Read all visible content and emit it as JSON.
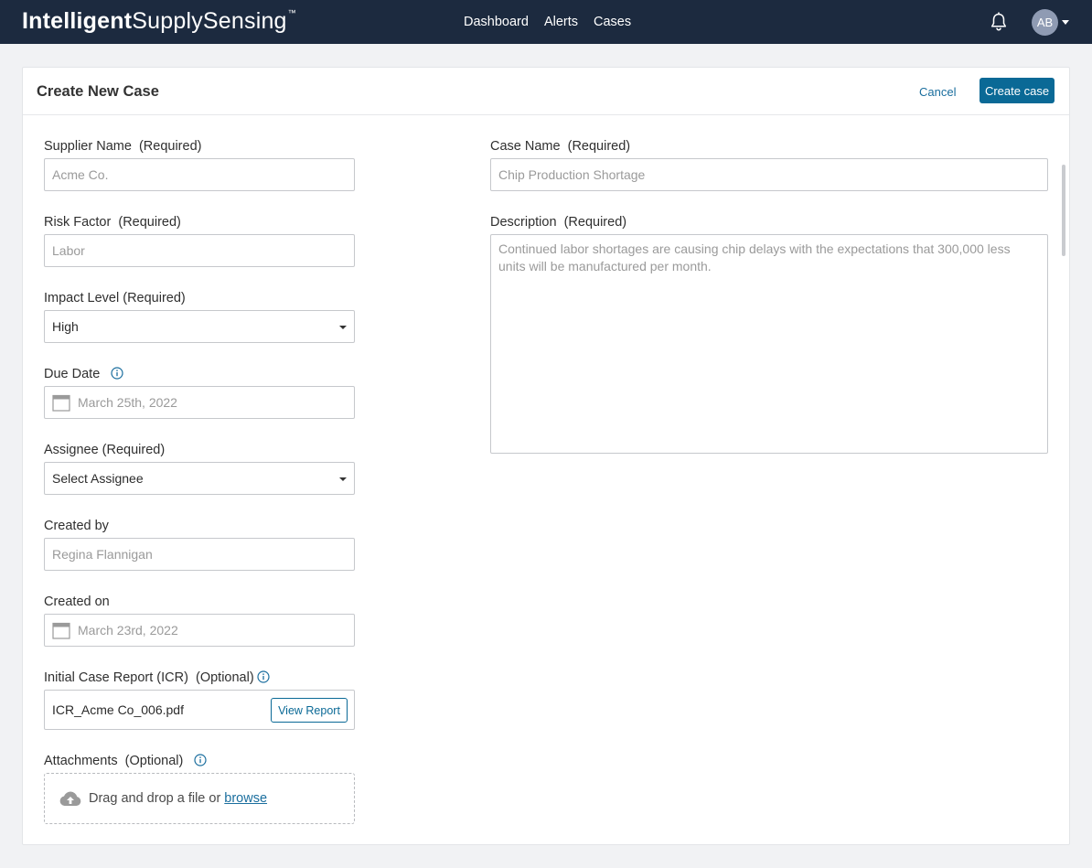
{
  "app": {
    "brand_bold": "Intelligent",
    "brand_rest": "SupplySensing",
    "brand_tm": "™",
    "nav": [
      "Dashboard",
      "Alerts",
      "Cases"
    ],
    "avatar_initials": "AB"
  },
  "page": {
    "title": "Create New Case",
    "cancel_label": "Cancel",
    "create_label": "Create case"
  },
  "form": {
    "supplier_name": {
      "label": "Supplier Name  (Required)",
      "placeholder": "Acme Co."
    },
    "risk_factor": {
      "label": "Risk Factor  (Required)",
      "placeholder": "Labor"
    },
    "impact_level": {
      "label": "Impact Level (Required)",
      "value": "High"
    },
    "due_date": {
      "label": "Due Date",
      "placeholder": "March 25th, 2022"
    },
    "assignee": {
      "label": "Assignee (Required)",
      "value": "Select Assignee"
    },
    "created_by": {
      "label": "Created by",
      "placeholder": "Regina Flannigan"
    },
    "created_on": {
      "label": "Created on",
      "placeholder": "March 23rd, 2022"
    },
    "icr": {
      "label": "Initial Case Report (ICR)  (Optional)",
      "file_name": "ICR_Acme Co_006.pdf",
      "button_label": "View Report"
    },
    "attachments": {
      "label": "Attachments  (Optional)",
      "drop_text": "Drag and drop a file or",
      "browse_label": "browse"
    },
    "case_name": {
      "label": "Case Name  (Required)",
      "placeholder": "Chip Production Shortage"
    },
    "description": {
      "label": "Description  (Required)",
      "placeholder": "Continued labor shortages are causing chip delays with the expectations that 300,000 less units will be manufactured per month."
    }
  },
  "icons": {
    "bell": "bell-icon",
    "calendar": "calendar-icon",
    "info": "info-icon",
    "upload": "cloud-upload-icon"
  },
  "colors": {
    "navbar": "#1c2a3f",
    "primary": "#0a6996",
    "link": "#1a6e9e"
  }
}
